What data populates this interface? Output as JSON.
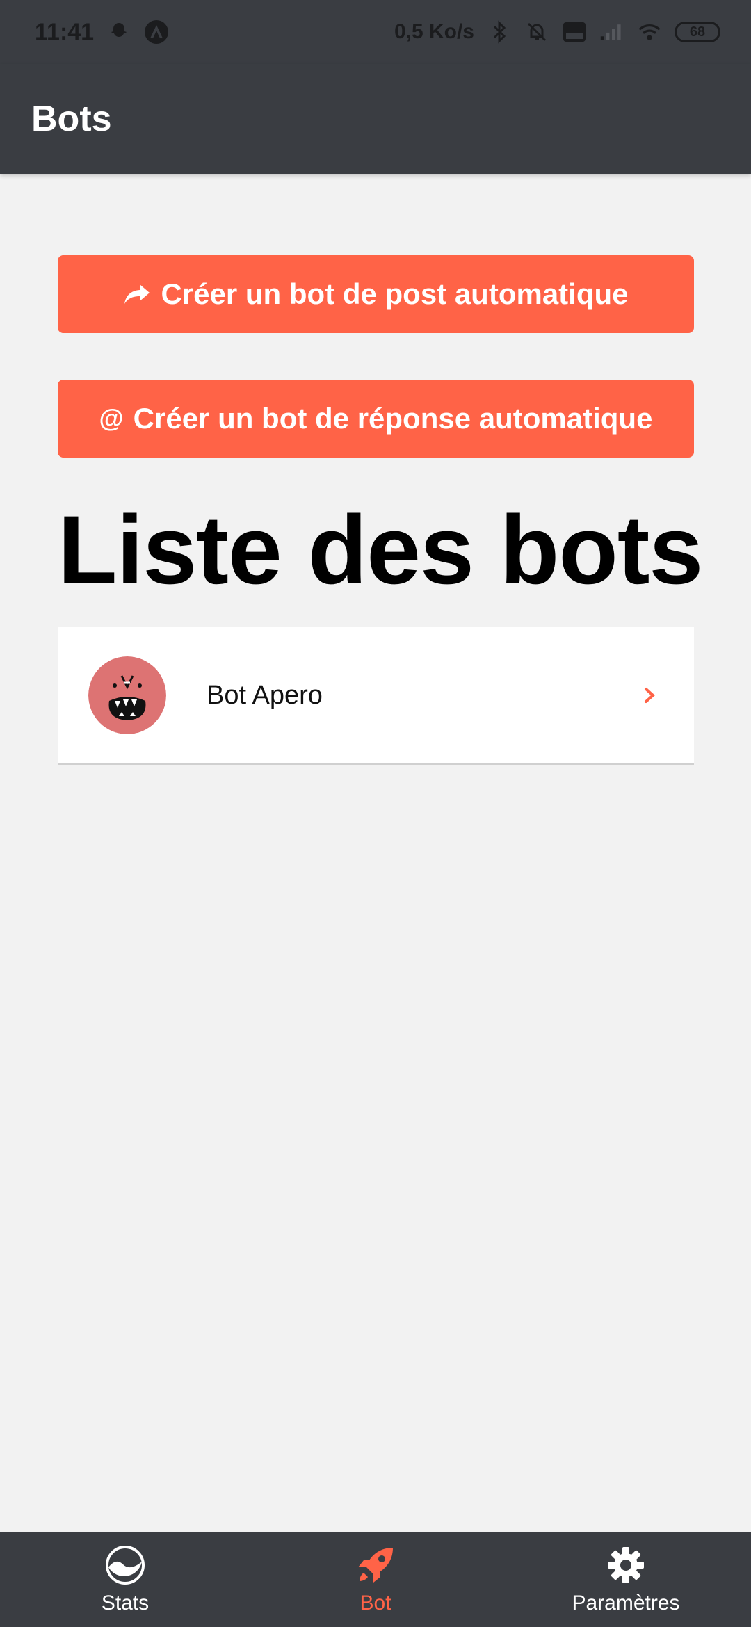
{
  "status_bar": {
    "time": "11:41",
    "speed": "0,5 Ko/s",
    "battery": "68",
    "left_icons": [
      "snapchat-icon",
      "app-icon"
    ],
    "right_icons": [
      "bluetooth-icon",
      "bell-off-icon",
      "volte-icon",
      "signal-icon",
      "wifi-icon"
    ]
  },
  "app_bar": {
    "title": "Bots"
  },
  "actions": {
    "post_bot_label": "Créer un bot de post automatique",
    "post_bot_icon": "share-arrow-icon",
    "reply_bot_label": "Créer un bot de réponse automatique",
    "reply_bot_icon_text": "@"
  },
  "list": {
    "title": "Liste des bots",
    "items": [
      {
        "name": "Bot Apero",
        "avatar": "avatar-monster-icon"
      }
    ]
  },
  "bottom_nav": {
    "items": [
      {
        "label": "Stats",
        "icon": "stats-icon",
        "active": false
      },
      {
        "label": "Bot",
        "icon": "rocket-icon",
        "active": true
      },
      {
        "label": "Paramètres",
        "icon": "gear-icon",
        "active": false
      }
    ]
  },
  "colors": {
    "accent": "#ff6347",
    "bar_bg": "#3a3d42",
    "page_bg": "#f2f2f2"
  }
}
